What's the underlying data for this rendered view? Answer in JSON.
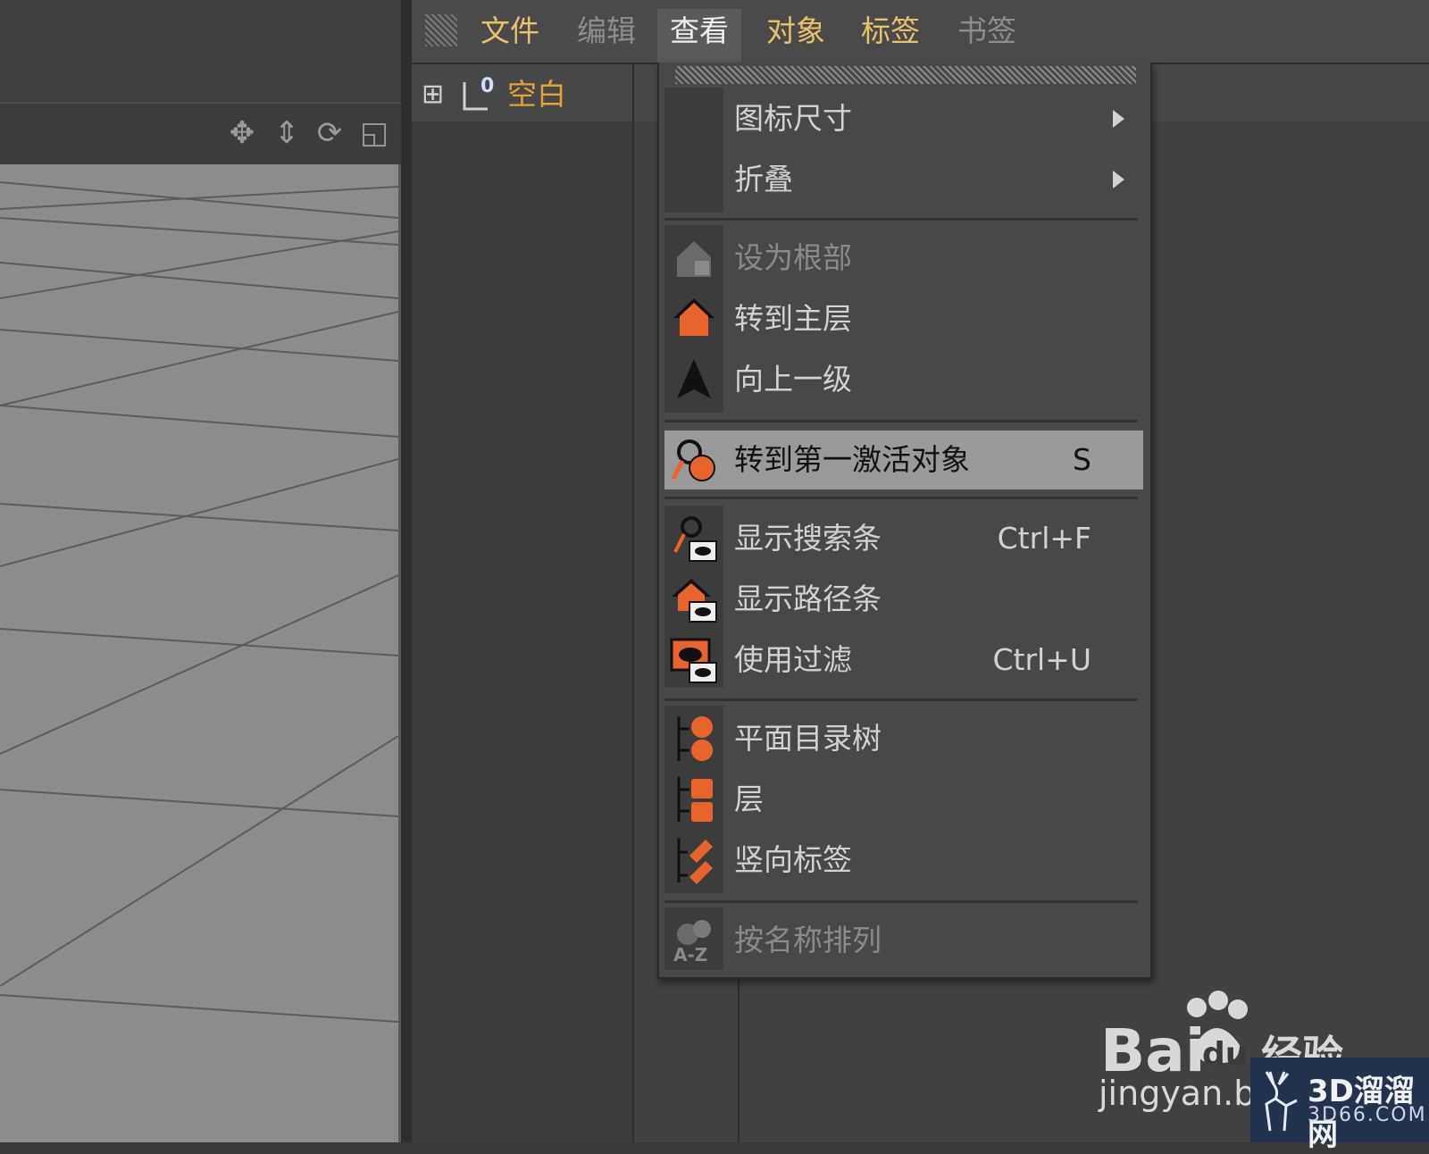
{
  "menubar": {
    "items": [
      {
        "label": "文件"
      },
      {
        "label": "编辑"
      },
      {
        "label": "查看"
      },
      {
        "label": "对象"
      },
      {
        "label": "标签"
      },
      {
        "label": "书签"
      }
    ],
    "active": "查看"
  },
  "object_tree": {
    "object_name": "空白",
    "layer_badge": "0"
  },
  "dropdown": {
    "items": [
      {
        "label": "图标尺寸",
        "submenu": true
      },
      {
        "label": "折叠",
        "submenu": true
      },
      {
        "label": "设为根部",
        "disabled": true,
        "icon": "set-root-icon"
      },
      {
        "label": "转到主层",
        "icon": "home-icon"
      },
      {
        "label": "向上一级",
        "icon": "up-arrow-icon"
      },
      {
        "label": "转到第一激活对象",
        "shortcut": "S",
        "highlighted": true,
        "icon": "search-object-icon"
      },
      {
        "label": "显示搜索条",
        "shortcut": "Ctrl+F",
        "icon": "show-search-icon"
      },
      {
        "label": "显示路径条",
        "icon": "show-path-icon"
      },
      {
        "label": "使用过滤",
        "shortcut": "Ctrl+U",
        "icon": "filter-icon"
      },
      {
        "label": "平面目录树",
        "icon": "flat-tree-icon"
      },
      {
        "label": "层",
        "icon": "layer-icon"
      },
      {
        "label": "竖向标签",
        "icon": "vertical-tags-icon"
      },
      {
        "label": "按名称排列",
        "disabled": true,
        "icon": "sort-az-icon"
      }
    ]
  },
  "watermark": {
    "baidu": "Bai",
    "du": "du",
    "jingyan_cn": "经验",
    "jingyan_url": "jingyan.bai",
    "brand": "3D溜溜网",
    "brand_url": "3D66.COM"
  },
  "colors": {
    "accent_orange": "#e8642c",
    "menu_yellow": "#e8c36b",
    "object_orange": "#e0a23a",
    "highlight": "#9a9a9a"
  }
}
